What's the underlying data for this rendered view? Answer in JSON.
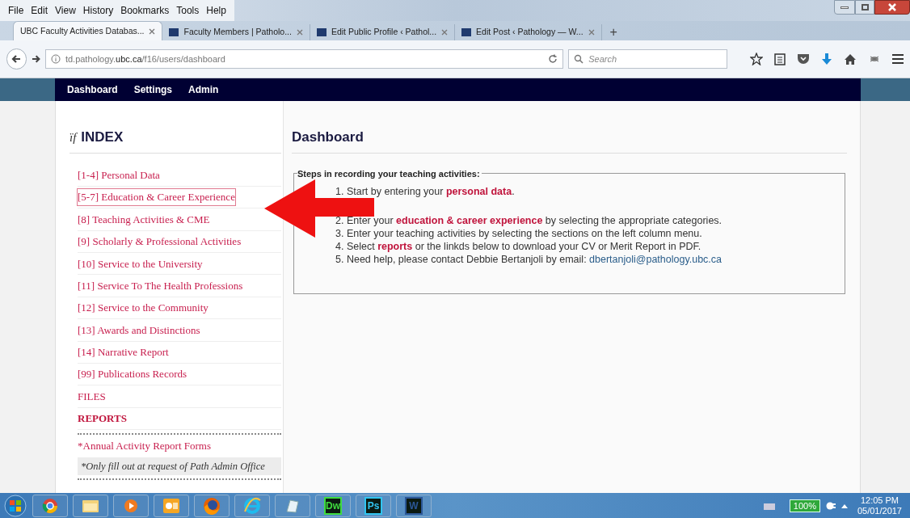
{
  "menu_bar": [
    "File",
    "Edit",
    "View",
    "History",
    "Bookmarks",
    "Tools",
    "Help"
  ],
  "tabs": [
    {
      "title": "UBC Faculty Activities Databas...",
      "selected": true,
      "favicon": false
    },
    {
      "title": "Faculty Members | Patholo...",
      "selected": false,
      "favicon": true
    },
    {
      "title": "Edit Public Profile ‹ Pathol...",
      "selected": false,
      "favicon": true
    },
    {
      "title": "Edit Post ‹ Pathology — W...",
      "selected": false,
      "favicon": true
    }
  ],
  "new_tab": "+",
  "address_bar": {
    "url_pre": "td.pathology.",
    "url_domain": "ubc.ca",
    "url_post": "/f16/users/dashboard"
  },
  "search": {
    "placeholder": "Search"
  },
  "site_nav": [
    "Dashboard",
    "Settings",
    "Admin"
  ],
  "sidebar": {
    "logo": "ïf",
    "title": "INDEX",
    "items": [
      {
        "kind": "link",
        "label": "[1-4] Personal Data",
        "selected": false
      },
      {
        "kind": "link",
        "label": "[5-7] Education & Career Experience",
        "selected": true
      },
      {
        "kind": "link",
        "label": "[8] Teaching Activities & CME",
        "selected": false
      },
      {
        "kind": "link",
        "label": "[9] Scholarly & Professional Activities",
        "selected": false
      },
      {
        "kind": "link",
        "label": "[10] Service to the University",
        "selected": false
      },
      {
        "kind": "link",
        "label": "[11] Service To The Health Professions",
        "selected": false
      },
      {
        "kind": "link",
        "label": "[12] Service to the Community",
        "selected": false
      },
      {
        "kind": "link",
        "label": "[13] Awards and Distinctions",
        "selected": false
      },
      {
        "kind": "link",
        "label": "[14] Narrative Report",
        "selected": false
      },
      {
        "kind": "link",
        "label": "[99] Publications Records",
        "selected": false
      },
      {
        "kind": "link",
        "label": "FILES",
        "selected": false
      },
      {
        "kind": "heading",
        "label": "REPORTS",
        "selected": false
      }
    ],
    "forms_link": "*Annual Activity Report Forms",
    "note": "*Only fill out at request of Path Admin Office"
  },
  "main": {
    "title": "Dashboard",
    "box_title": "Steps in recording your teaching activities:",
    "step_groups": [
      [
        {
          "text": "1. Start by entering your **personal data**."
        }
      ],
      [
        {
          "text": "2. Enter your **education & career experience** by selecting the appropriate categories."
        },
        {
          "text": "3. Enter your teaching activities by selecting the sections on the left column menu."
        },
        {
          "text": "4. Select **reports** or the linkds below to download your CV or Merit Report in PDF."
        },
        {
          "text": "5. Need help, please contact Debbie Bertanjoli by email: ",
          "link": "dbertanjoli@pathology.ubc.ca"
        }
      ]
    ]
  },
  "taskbar": {
    "apps": [
      {
        "kind": "chrome"
      },
      {
        "kind": "folder"
      },
      {
        "kind": "media"
      },
      {
        "kind": "outlook"
      },
      {
        "kind": "firefox"
      },
      {
        "kind": "ie"
      },
      {
        "kind": "notepad"
      },
      {
        "kind": "label",
        "label": "Dw",
        "color": "#3fdc3f"
      },
      {
        "kind": "label",
        "label": "Ps",
        "color": "#31c5f0"
      },
      {
        "kind": "label",
        "label": "W",
        "color": "#2b5797"
      }
    ],
    "battery": "100%",
    "time": "12:05 PM",
    "date": "05/01/2017"
  }
}
